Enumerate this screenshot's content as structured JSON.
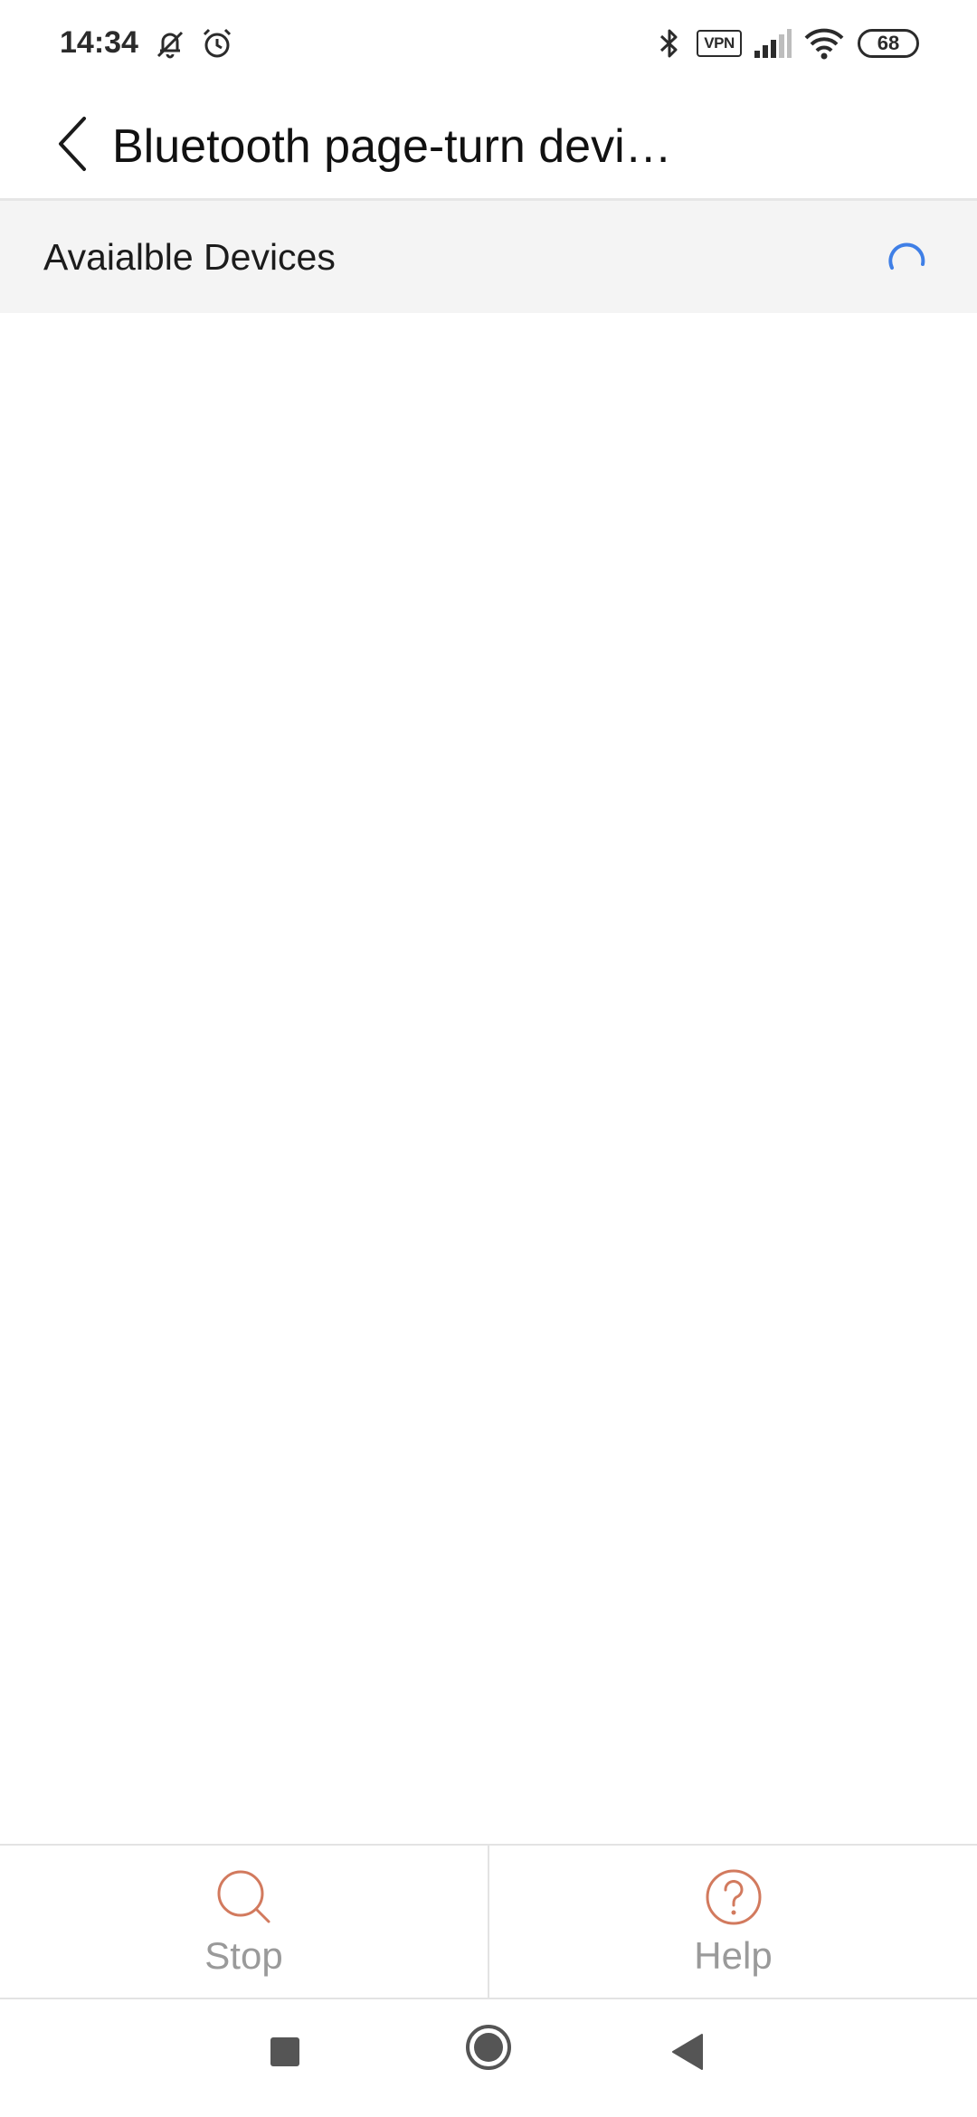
{
  "status_bar": {
    "time": "14:34",
    "battery": "68",
    "vpn": "VPN",
    "icons": [
      "muted-bell-icon",
      "alarm-icon",
      "bluetooth-icon",
      "vpn-icon",
      "signal-icon",
      "wifi-icon",
      "battery-icon"
    ]
  },
  "header": {
    "title": "Bluetooth page-turn devi…",
    "back_icon": "chevron-left-icon"
  },
  "section": {
    "label": "Avaialble Devices",
    "loading_icon": "spinner-icon"
  },
  "actions": {
    "stop": {
      "label": "Stop",
      "icon": "search-icon"
    },
    "help": {
      "label": "Help",
      "icon": "help-circle-icon"
    }
  },
  "nav": {
    "recents_icon": "square-icon",
    "home_icon": "circle-icon",
    "back_icon": "triangle-back-icon"
  },
  "colors": {
    "accent_orange": "#d27a5e",
    "spinner_blue": "#3f7fe6",
    "section_bg": "#f4f4f4",
    "label_gray": "#9a9a9a"
  }
}
